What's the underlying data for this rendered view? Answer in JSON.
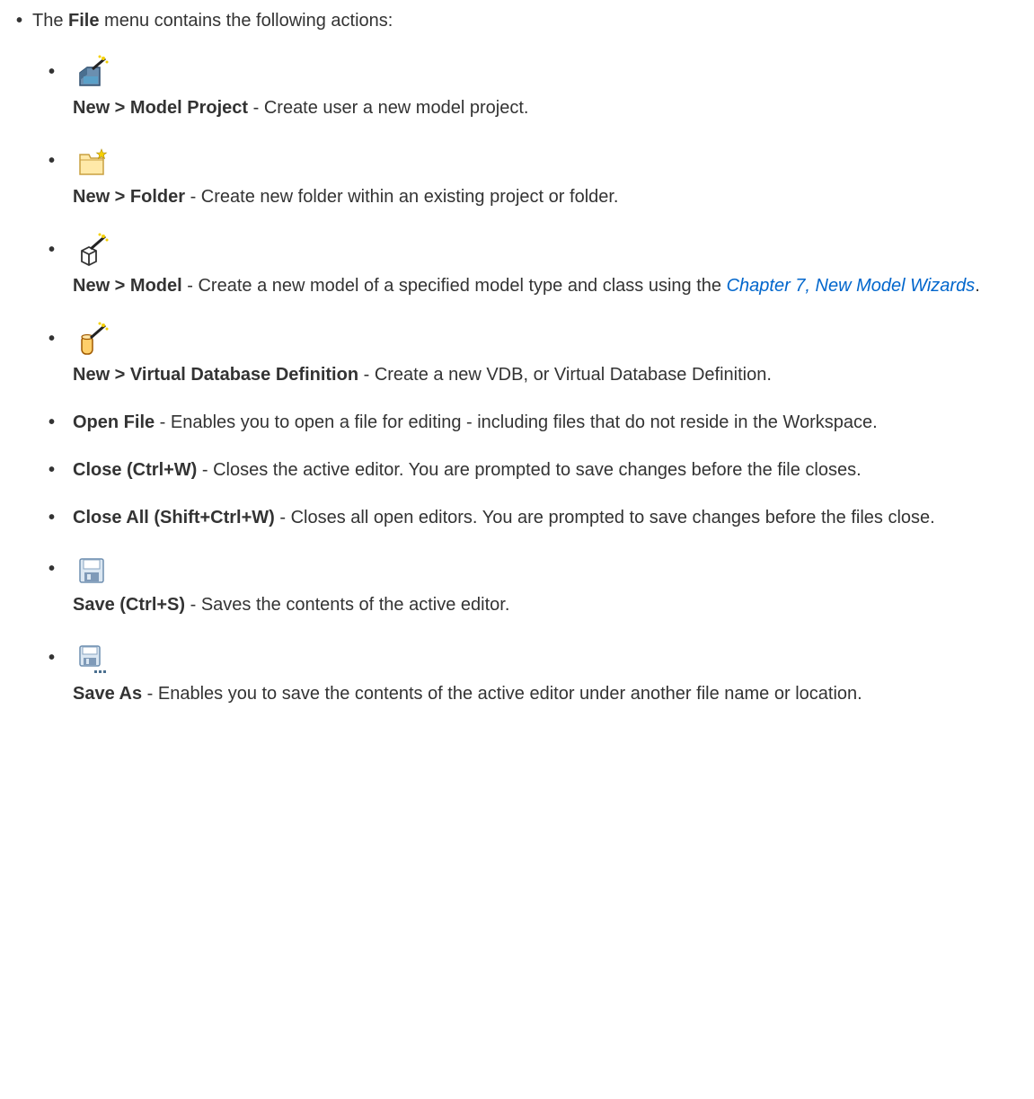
{
  "intro": {
    "prefix": "The ",
    "menu_name": "File",
    "suffix": " menu contains the following actions:"
  },
  "items": [
    {
      "icon": "new-model-project-icon",
      "term": "New > Model Project",
      "text": " - Create user a new model project."
    },
    {
      "icon": "new-folder-icon",
      "term": "New > Folder",
      "text": " - Create new folder within an existing project or folder."
    },
    {
      "icon": "new-model-icon",
      "term": "New > Model",
      "text": " - Create a new model of a specified model type and class using the ",
      "link_text": "Chapter 7, New Model Wizards",
      "after_link": "."
    },
    {
      "icon": "new-vdb-icon",
      "term": "New > Virtual Database Definition",
      "text": " - Create a new VDB, or Virtual Database Definition."
    },
    {
      "term": "Open File",
      "text": " - Enables you to open a file for editing - including files that do not reside in the Workspace."
    },
    {
      "term": "Close (Ctrl+W)",
      "text": " - Closes the active editor. You are prompted to save changes before the file closes."
    },
    {
      "term": "Close All (Shift+Ctrl+W)",
      "text": " - Closes all open editors. You are prompted to save changes before the files close."
    },
    {
      "icon": "save-icon",
      "term": "Save (Ctrl+S)",
      "text": " - Saves the contents of the active editor."
    },
    {
      "icon": "save-as-icon",
      "term": "Save As",
      "text": " - Enables you to save the contents of the active editor under another file name or location."
    }
  ],
  "colors": {
    "text": "#333333",
    "link": "#0066cc"
  }
}
